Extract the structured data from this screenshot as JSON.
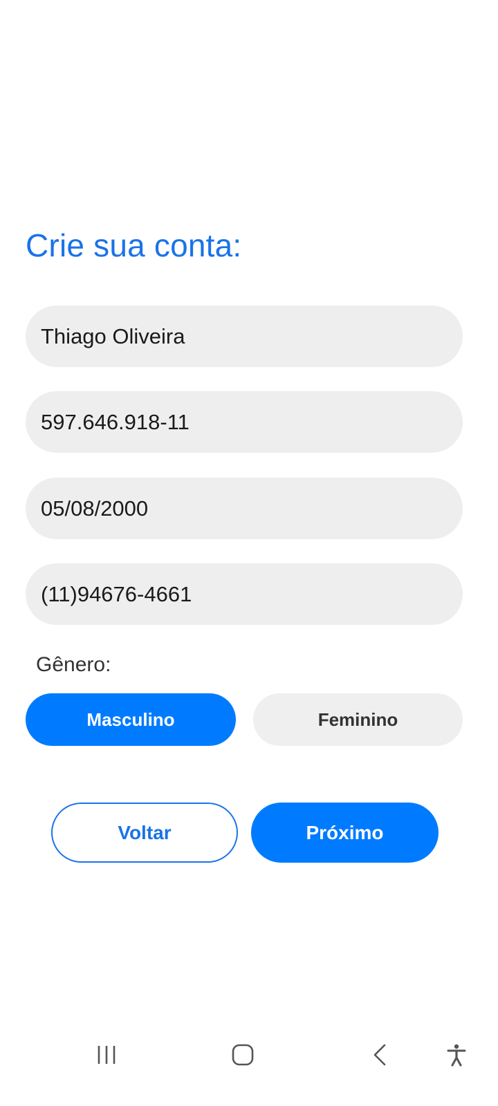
{
  "title": "Crie sua conta:",
  "fields": {
    "name": "Thiago Oliveira",
    "cpf": "597.646.918-11",
    "birthdate": "05/08/2000",
    "phone": "(11)94676-4661"
  },
  "gender": {
    "label": "Gênero:",
    "options": [
      "Masculino",
      "Feminino"
    ],
    "selected": "Masculino"
  },
  "actions": {
    "back_label": "Voltar",
    "next_label": "Próximo"
  },
  "nav_icons": [
    "recent-apps-icon",
    "home-icon",
    "back-icon",
    "accessibility-icon"
  ],
  "colors": {
    "accent": "#007bff",
    "title": "#1a73e8",
    "field_bg": "#eeeeee"
  }
}
